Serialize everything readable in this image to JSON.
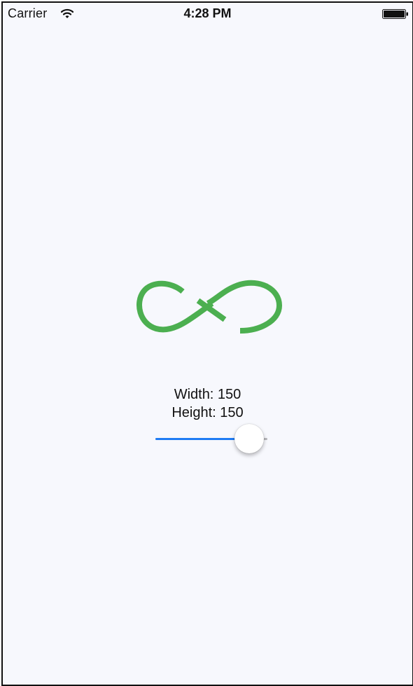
{
  "status_bar": {
    "carrier": "Carrier",
    "time": "4:28 PM",
    "icons": [
      "wifi-icon",
      "battery-icon"
    ]
  },
  "logo": {
    "icon": "infinity-logo",
    "color": "#4caf50"
  },
  "dimensions": {
    "width_label": "Width: 150",
    "height_label": "Height: 150"
  },
  "slider": {
    "value_fraction": 0.84,
    "fill_color": "#1f7cf4",
    "track_color": "#b7b7bb"
  },
  "colors": {
    "background": "#f7f8fd",
    "text": "#111111"
  }
}
